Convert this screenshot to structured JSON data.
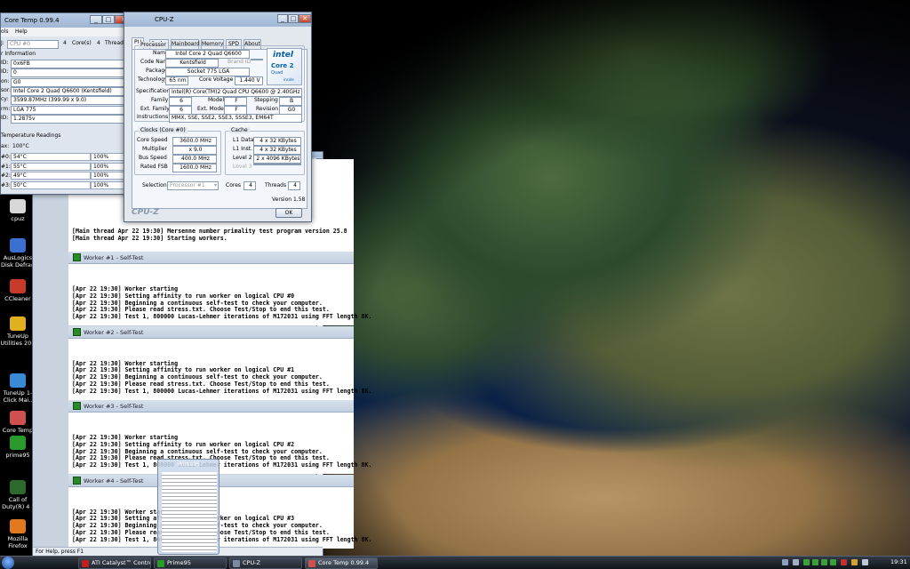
{
  "desktop_icons": [
    {
      "label": "cpuz",
      "color": "#d8d8d8"
    },
    {
      "label": "AusLogics Disk Defrag",
      "color": "#3b6fd0"
    },
    {
      "label": "CCleaner",
      "color": "#c83a2a"
    },
    {
      "label": "TuneUp Utilities 200",
      "color": "#e0b020"
    },
    {
      "label": "TuneUp 1-Click Mai..",
      "color": "#3a8ad8"
    },
    {
      "label": "Core Temp",
      "color": "#d05050"
    },
    {
      "label": "prime95",
      "color": "#2a9a2a"
    },
    {
      "label": "Call of Duty(R) 4 -",
      "color": "#2a6a2a"
    },
    {
      "label": "Mozilla Firefox",
      "color": "#e07a20"
    }
  ],
  "coretemp": {
    "title": "Core Temp 0.99.4",
    "menu": [
      "ols",
      "Help"
    ],
    "cpu_select": "CPU #0",
    "cores_count": "4",
    "cores_label": "Core(s)",
    "threads_count": "4",
    "threads_label": "Thread(s)",
    "info_header": "r Information",
    "info_rows": [
      {
        "label": "ID:",
        "value": "0x6FB"
      },
      {
        "label": "ID:",
        "value": "0"
      },
      {
        "label": "on:",
        "value": "G0"
      },
      {
        "label": "sor:",
        "value": "Intel Core 2 Quad Q6600 (Kentsfield)"
      },
      {
        "label": "cy:",
        "value": "3599.87MHz (399.99 x 9.0)"
      },
      {
        "label": "rm:",
        "value": "LGA 775"
      },
      {
        "label": "ID:",
        "value": "1.2875v"
      }
    ],
    "temp_header": "Temperature Readings",
    "tjmax_label": "ax:",
    "tjmax_value": "100°C",
    "cores": [
      {
        "label": "#0:",
        "temp": "54°C",
        "load": "100%"
      },
      {
        "label": "#1:",
        "temp": "55°C",
        "load": "100%"
      },
      {
        "label": "#2:",
        "temp": "49°C",
        "load": "100%"
      },
      {
        "label": "#3:",
        "temp": "50°C",
        "load": "100%"
      }
    ]
  },
  "cpuz": {
    "title": "CPU-Z",
    "tabs": [
      "PU",
      "Cache",
      "Mainboard",
      "Memory",
      "SPD",
      "About"
    ],
    "processor_group": "Processor",
    "name_label": "Name",
    "name_value": "Intel Core 2 Quad Q6600",
    "codename_label": "Code Name",
    "codename_value": "Kentsfield",
    "brand_label": "Brand ID",
    "package_label": "Package",
    "package_value": "Socket 775 LGA",
    "tech_label": "Technology",
    "tech_value": "65 nm",
    "voltage_label": "Core Voltage",
    "voltage_value": "1.440 V",
    "spec_label": "Specification",
    "spec_value": "Intel(R) Core(TM)2 Quad CPU    Q6600  @ 2.40GHz",
    "family_label": "Family",
    "family_value": "6",
    "model_label": "Model",
    "model_value": "F",
    "stepping_label": "Stepping",
    "stepping_value": "B",
    "extfamily_label": "Ext. Family",
    "extfamily_value": "6",
    "extmodel_label": "Ext. Model",
    "extmodel_value": "F",
    "revision_label": "Revision",
    "revision_value": "G0",
    "instr_label": "Instructions",
    "instr_value": "MMX, SSE, SSE2, SSE3, SSSE3, EM64T",
    "clocks_group": "Clocks (Core #0)",
    "corespeed_label": "Core Speed",
    "corespeed_value": "3600.0 MHz",
    "mult_label": "Multiplier",
    "mult_value": "x 9.0",
    "bus_label": "Bus Speed",
    "bus_value": "400.0 MHz",
    "fsb_label": "Rated FSB",
    "fsb_value": "1600.0 MHz",
    "cache_group": "Cache",
    "l1d_label": "L1 Data",
    "l1d_value": "4 x 32 KBytes",
    "l1i_label": "L1 Inst.",
    "l1i_value": "4 x 32 KBytes",
    "l2_label": "Level 2",
    "l2_value": "2 x 4096 KBytes",
    "l3_label": "Level 3",
    "selection_label": "Selection",
    "selection_value": "Processor #1",
    "cores_label": "Cores",
    "cores_value": "4",
    "threads_label": "Threads",
    "threads_value": "4",
    "version": "Version 1.58",
    "brand": "CPU-Z",
    "ok": "OK",
    "logo": {
      "intel": "intel",
      "core": "Core 2",
      "quad": "Quad",
      "inside": "inside"
    }
  },
  "prime": {
    "main_lines": [
      "[Main thread Apr 22 19:30] Mersenne number primality test program version 25.8",
      "[Main thread Apr 22 19:30] Starting workers."
    ],
    "workers": [
      {
        "title": "Worker #1 - Self-Test",
        "lines": [
          "[Apr 22 19:30] Worker starting",
          "[Apr 22 19:30] Setting affinity to run worker on logical CPU #0",
          "[Apr 22 19:30] Beginning a continuous self-test to check your computer.",
          "[Apr 22 19:30] Please read stress.txt.  Choose Test/Stop to end this test.",
          "[Apr 22 19:30] Test 1, 800000 Lucas-Lehmer iterations of M172031 using FFT length 8K."
        ]
      },
      {
        "title": "Worker #2 - Self-Test",
        "lines": [
          "[Apr 22 19:30] Worker starting",
          "[Apr 22 19:30] Setting affinity to run worker on logical CPU #1",
          "[Apr 22 19:30] Beginning a continuous self-test to check your computer.",
          "[Apr 22 19:30] Please read stress.txt.  Choose Test/Stop to end this test.",
          "[Apr 22 19:30] Test 1, 800000 Lucas-Lehmer iterations of M172031 using FFT length 8K."
        ]
      },
      {
        "title": "Worker #3 - Self-Test",
        "lines": [
          "[Apr 22 19:30] Worker starting",
          "[Apr 22 19:30] Setting affinity to run worker on logical CPU #2",
          "[Apr 22 19:30] Beginning a continuous self-test to check your computer.",
          "[Apr 22 19:30] Please read stress.txt.  Choose Test/Stop to end this test.",
          "[Apr 22 19:30] Test 1, 800000 Lucas-Lehmer iterations of M172031 using FFT length 8K."
        ]
      },
      {
        "title": "Worker #4 - Self-Test",
        "lines": [
          "[Apr 22 19:30] Worker starting",
          "[Apr 22 19:30] Setting affinity to run worker on logical CPU #3",
          "[Apr 22 19:30] Beginning a continuous self-test to check your computer.",
          "[Apr 22 19:30] Please read stress.txt.  Choose Test/Stop to end this test.",
          "[Apr 22 19:30] Test 1, 800000 Lucas-Lehmer iterations of M172031 using FFT length 8K."
        ]
      }
    ],
    "status": "For Help, press F1",
    "thumb_title": "Prime95"
  },
  "taskbar": {
    "buttons": [
      {
        "label": "ATI Catalyst™ Control C...",
        "color": "#c02020"
      },
      {
        "label": "Prime95",
        "color": "#2a9a2a"
      },
      {
        "label": "CPU-Z",
        "color": "#7a8aa0"
      },
      {
        "label": "Core Temp 0.99.4",
        "color": "#d05050"
      }
    ],
    "clock": "19:31"
  }
}
